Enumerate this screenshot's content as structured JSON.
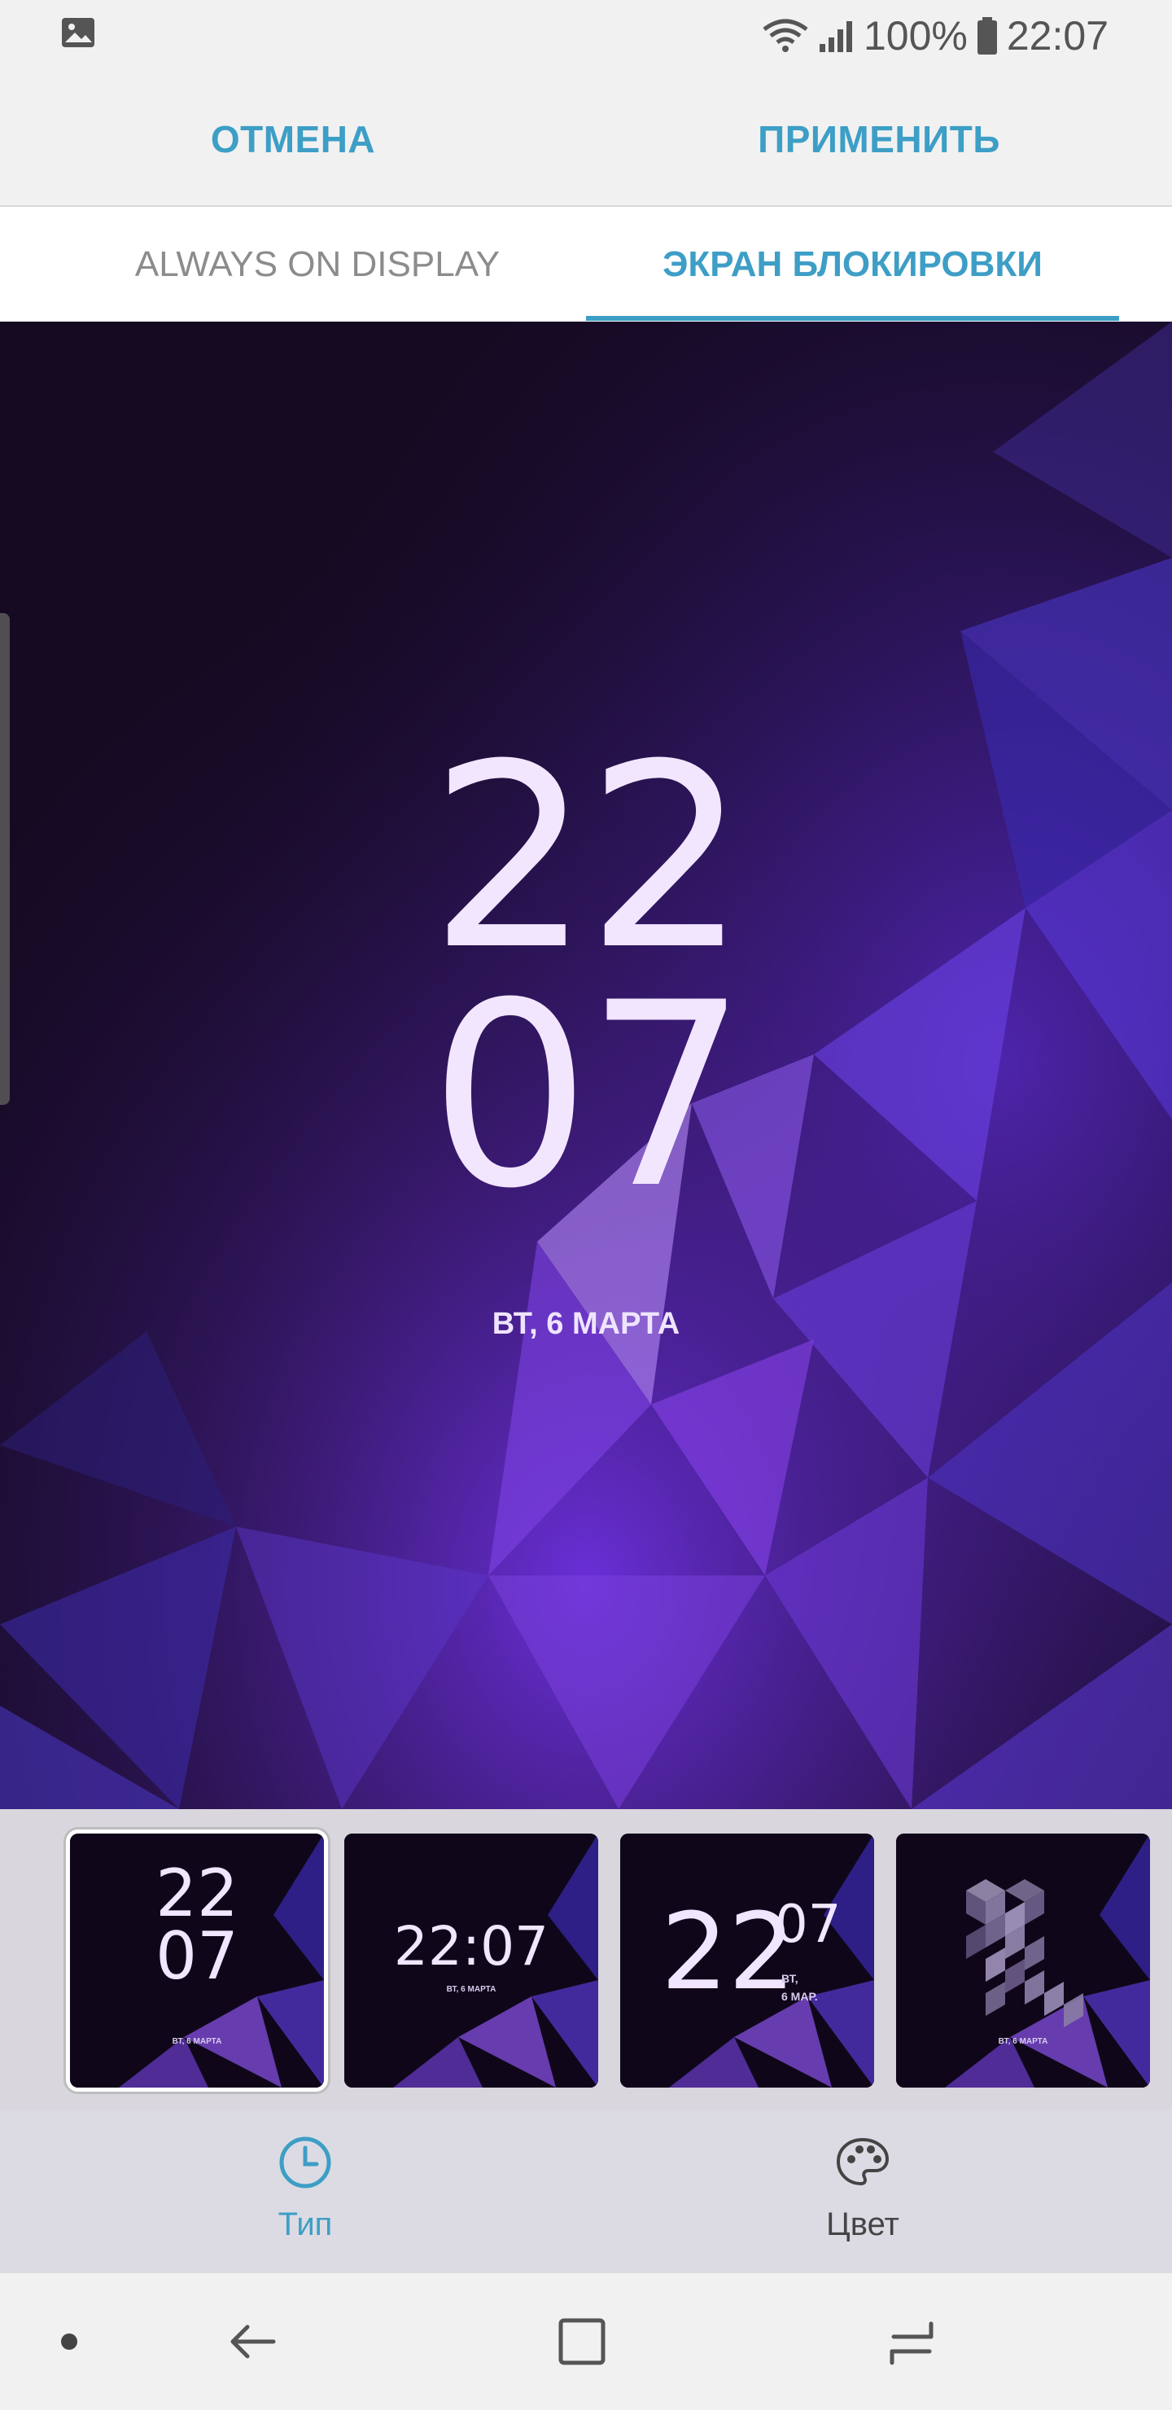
{
  "status_bar": {
    "left_icon": "image-notification-icon",
    "battery_percent": "100%",
    "time": "22:07"
  },
  "actions": {
    "cancel_label": "ОТМЕНА",
    "apply_label": "ПРИМЕНИТЬ"
  },
  "tabs": [
    {
      "label": "ALWAYS ON DISPLAY",
      "active": false
    },
    {
      "label": "ЭКРАН БЛОКИРОВКИ",
      "active": true
    }
  ],
  "preview": {
    "hours": "22",
    "minutes": "07",
    "date": "ВТ, 6 МАРТА"
  },
  "clock_styles": [
    {
      "hours": "22",
      "minutes": "07",
      "date": "ВТ, 6 МАРТА",
      "selected": true
    },
    {
      "time": "22:07",
      "date": "ВТ, 6 МАРТА",
      "selected": false
    },
    {
      "hours": "22",
      "minutes": "07",
      "day": "ВТ,",
      "date": "6 МАР.",
      "selected": false
    },
    {
      "date": "ВТ, 6 МАРТА",
      "selected": false
    }
  ],
  "bottom_tabs": {
    "type_label": "Тип",
    "color_label": "Цвет"
  },
  "colors": {
    "accent": "#3d9ec6",
    "wallpaper_dark": "#170a26",
    "wallpaper_purple": "#7b3fe4"
  },
  "nav": [
    "nav-dot-icon",
    "back-arrow-icon",
    "home-square-icon",
    "recents-icon"
  ]
}
